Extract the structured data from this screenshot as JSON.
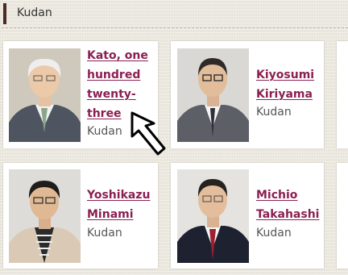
{
  "header": {
    "title": "Kudan"
  },
  "members": [
    {
      "name": "Kato, one\nhundred\ntwenty-\nthree",
      "group": "Kudan"
    },
    {
      "name": "Kiyosumi\nKiriyama",
      "group": "Kudan"
    },
    {
      "name": "Yoshikazu\nMinami",
      "group": "Kudan"
    },
    {
      "name": "Michio\nTakahashi",
      "group": "Kudan"
    }
  ],
  "colors": {
    "link": "#8b1f52",
    "accent": "#4a2b22",
    "background": "#ece8df"
  },
  "cursor_icon": "arrow-cursor-icon"
}
